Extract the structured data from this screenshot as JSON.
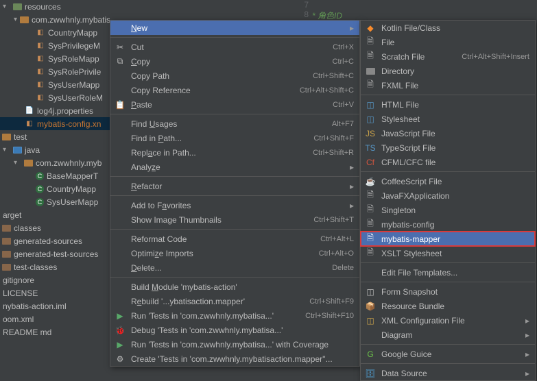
{
  "gutter": {
    "l7": "7",
    "l8": "8"
  },
  "code": {
    "star": "*",
    "comment": "角色ID"
  },
  "tree": {
    "resources": "resources",
    "pkg": "com.zwwhnly.mybatisaction.mapper",
    "files": [
      "CountryMapp",
      "SysPrivilegeM",
      "SysRoleMapp",
      "SysRolePrivile",
      "SysUserMapp",
      "SysUserRoleM"
    ],
    "log4j": "log4j.properties",
    "mybatis_config": "mybatis-config.xn",
    "test": "test",
    "java": "java",
    "pkg2": "com.zwwhnly.myb",
    "classes2": [
      "BaseMapperT",
      "CountryMapp",
      "SysUserMapp"
    ],
    "target": "arget",
    "tsub": [
      "classes",
      "generated-sources",
      "generated-test-sources",
      "test-classes"
    ],
    "gitignore": "gitignore",
    "license": "LICENSE",
    "iml": "nybatis-action.iml",
    "pom": "oom.xml",
    "readme": "README md"
  },
  "menu1": {
    "new": "New",
    "cut": "Cut",
    "cut_sc": "Ctrl+X",
    "copy": "Copy",
    "copy_sc": "Ctrl+C",
    "copy_path": "Copy Path",
    "copy_path_sc": "Ctrl+Shift+C",
    "copy_ref": "Copy Reference",
    "copy_ref_sc": "Ctrl+Alt+Shift+C",
    "paste": "Paste",
    "paste_sc": "Ctrl+V",
    "find_usages": "Find Usages",
    "find_usages_sc": "Alt+F7",
    "find_in_path": "Find in Path...",
    "find_in_path_sc": "Ctrl+Shift+F",
    "replace_in_path": "Replace in Path...",
    "replace_in_path_sc": "Ctrl+Shift+R",
    "analyze": "Analyze",
    "refactor": "Refactor",
    "fav": "Add to Favorites",
    "thumb": "Show Image Thumbnails",
    "thumb_sc": "Ctrl+Shift+T",
    "reformat": "Reformat Code",
    "reformat_sc": "Ctrl+Alt+L",
    "optimize": "Optimize Imports",
    "optimize_sc": "Ctrl+Alt+O",
    "delete": "Delete...",
    "delete_sc": "Delete",
    "build": "Build Module 'mybatis-action'",
    "rebuild": "Rebuild '...ybatisaction.mapper'",
    "rebuild_sc": "Ctrl+Shift+F9",
    "run": "Run 'Tests in 'com.zwwhnly.mybatisa...'",
    "run_sc": "Ctrl+Shift+F10",
    "debug": "Debug 'Tests in 'com.zwwhnly.mybatisa...'",
    "coverage": "Run 'Tests in 'com.zwwhnly.mybatisa...' with Coverage",
    "create": "Create 'Tests in 'com.zwwhnly.mybatisaction.mapper''..."
  },
  "menu2": {
    "kotlin": "Kotlin File/Class",
    "file": "File",
    "scratch": "Scratch File",
    "scratch_sc": "Ctrl+Alt+Shift+Insert",
    "directory": "Directory",
    "fxml": "FXML File",
    "html": "HTML File",
    "stylesheet": "Stylesheet",
    "js": "JavaScript File",
    "ts": "TypeScript File",
    "cfml": "CFML/CFC file",
    "coffee": "CoffeeScript File",
    "jfx": "JavaFXApplication",
    "singleton": "Singleton",
    "myb_config": "mybatis-config",
    "myb_mapper": "mybatis-mapper",
    "xslt": "XSLT Stylesheet",
    "edit_tpl": "Edit File Templates...",
    "form": "Form Snapshot",
    "bundle": "Resource Bundle",
    "xmlcfg": "XML Configuration File",
    "diagram": "Diagram",
    "guice": "Google Guice",
    "datasource": "Data Source"
  }
}
